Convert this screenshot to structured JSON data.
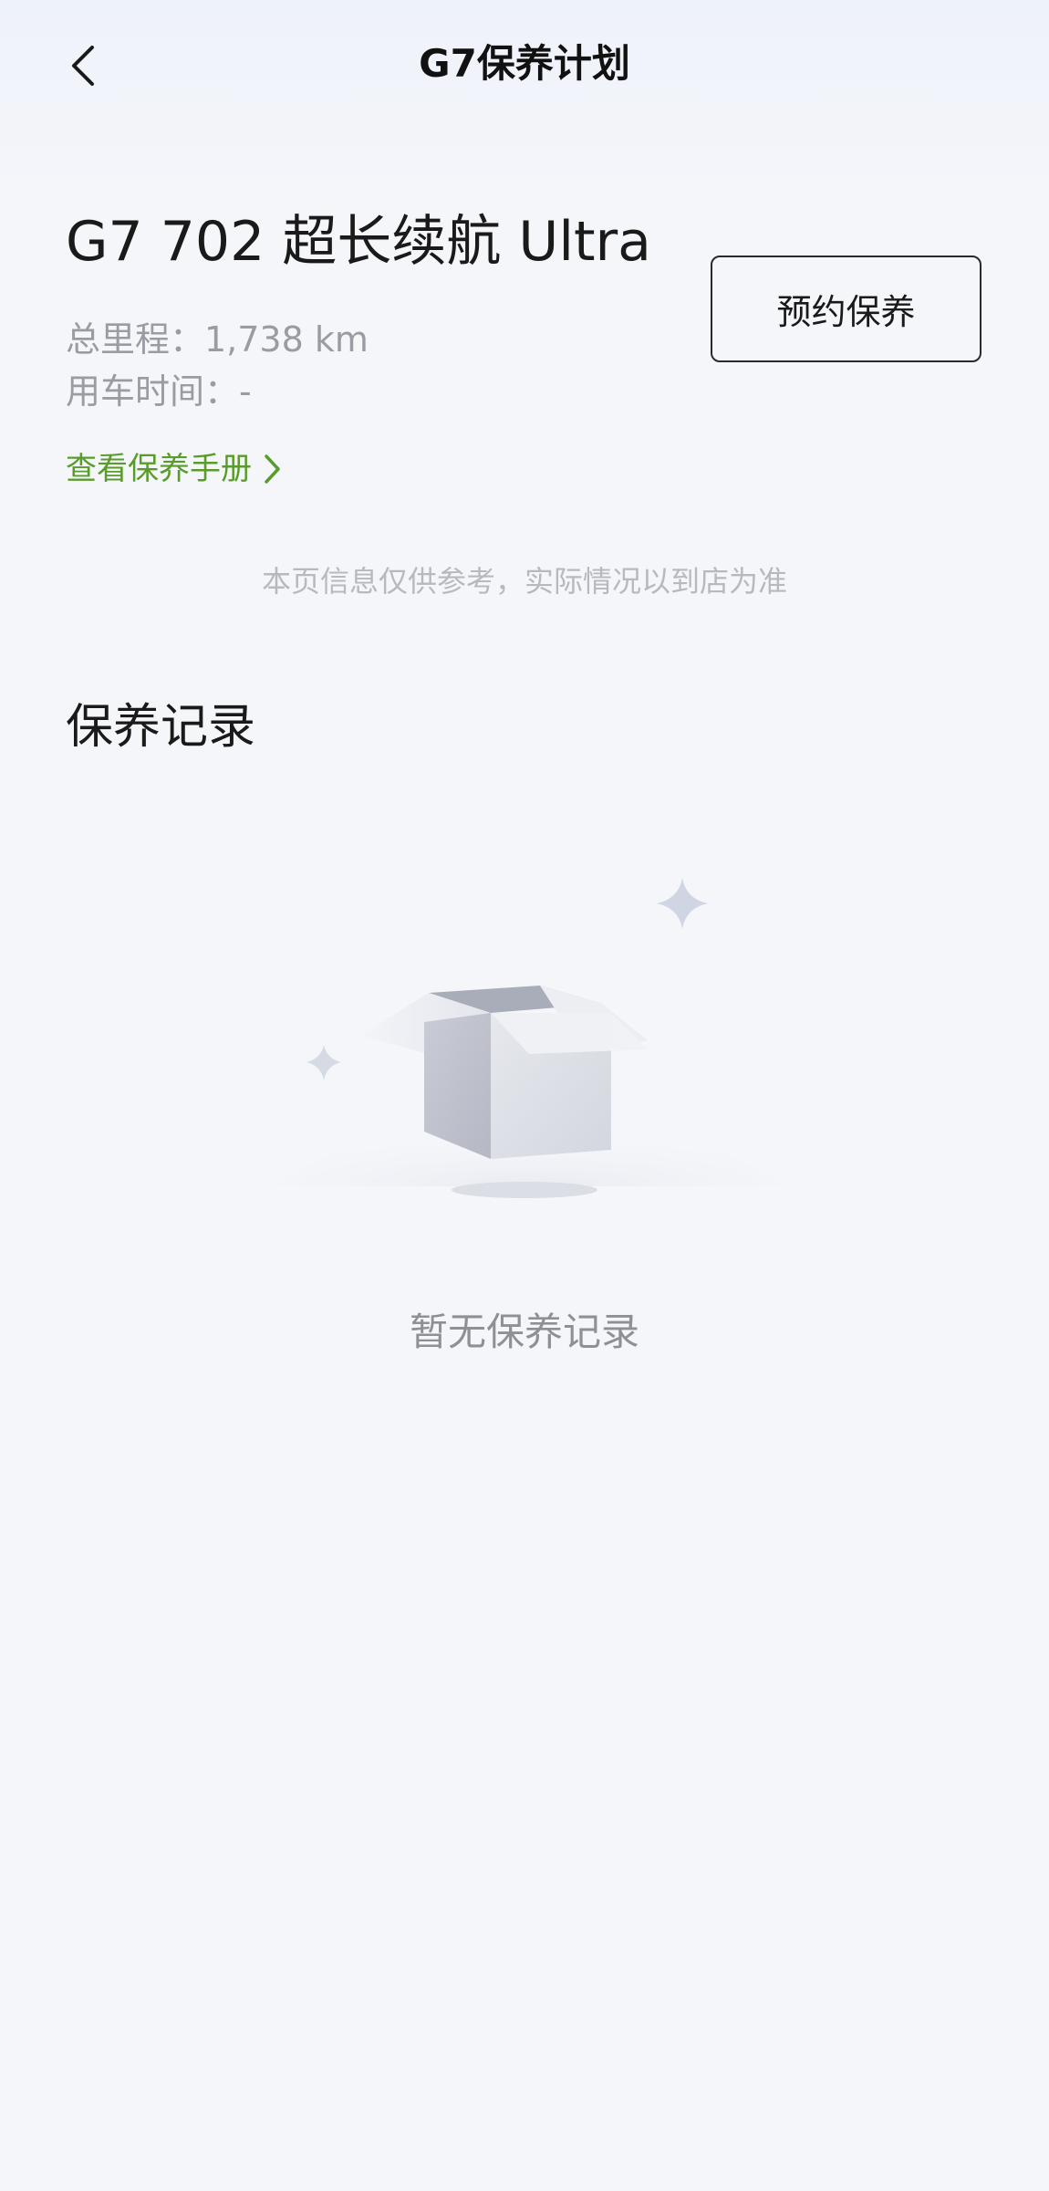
{
  "header": {
    "title": "G7保养计划"
  },
  "vehicle": {
    "name": "G7 702 超长续航 Ultra",
    "mileage": "总里程：1,738 km",
    "usage_time": "用车时间：-"
  },
  "actions": {
    "book_maintenance": "预约保养",
    "view_manual": "查看保养手册"
  },
  "disclaimer": "本页信息仅供参考，实际情况以到店为准",
  "records": {
    "section_title": "保养记录",
    "empty_text": "暂无保养记录"
  },
  "colors": {
    "accent_green": "#5a9c2b",
    "background": "#f5f6fa",
    "muted_text": "#9a9ca3"
  },
  "icons": {
    "back": "chevron-left-icon",
    "link_arrow": "chevron-right-icon",
    "empty_state": "empty-box-icon"
  }
}
